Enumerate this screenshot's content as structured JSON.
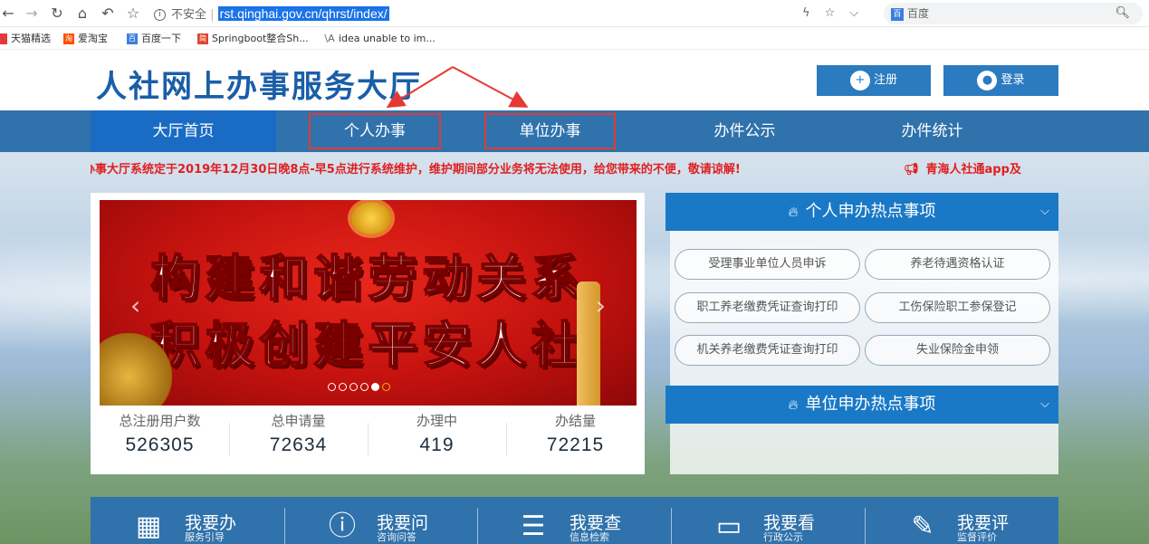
{
  "browser": {
    "security_label": "不安全",
    "url": "rst.qinghai.gov.cn/qhrst/index/",
    "search_engine": "百度",
    "icons": [
      "back-icon",
      "forward-icon",
      "reload-icon",
      "home-icon",
      "history-back-icon",
      "star-icon"
    ]
  },
  "bookmarks": [
    {
      "label": "天猫精选",
      "color": "#e4393c"
    },
    {
      "label": "爱淘宝",
      "color": "#ff5000"
    },
    {
      "label": "百度一下",
      "color": "#3a7fe0"
    },
    {
      "label": "Springboot整合Sh...",
      "color": "#e2452f"
    },
    {
      "label": "idea unable to im...",
      "color": "#666666"
    }
  ],
  "header": {
    "title": "人社网上办事服务大厅",
    "register_label": "注册",
    "login_label": "登录"
  },
  "nav": [
    {
      "label": "大厅首页"
    },
    {
      "label": "个人办事"
    },
    {
      "label": "单位办事"
    },
    {
      "label": "办件公示"
    },
    {
      "label": "办件统计"
    }
  ],
  "notice": {
    "text": "办事大厅系统定于2019年12月30日晚8点-早5点进行系统维护，维护期间部分业务将无法使用，给您带来的不便，敬请谅解!",
    "text_visible": "办事大厅系统定于2019年12月30日晚8点-早5点进行系统维护，维护期间部分业务将无法使用，给您带来的不便，敬请谅解!",
    "second": "青海人社通app及"
  },
  "banner": {
    "line1": "构建和谐劳动关系",
    "line2": "积极创建平安人社",
    "slides": 6,
    "active_slide": 5
  },
  "stats": [
    {
      "label": "总注册用户数",
      "value": "526305"
    },
    {
      "label": "总申请量",
      "value": "72634"
    },
    {
      "label": "办理中",
      "value": "419"
    },
    {
      "label": "办结量",
      "value": "72215"
    }
  ],
  "personal_hot": {
    "title": "个人申办热点事项",
    "items": [
      "受理事业单位人员申诉",
      "养老待遇资格认证",
      "职工养老缴费凭证查询打印",
      "工伤保险职工参保登记",
      "机关养老缴费凭证查询打印",
      "失业保险金申领"
    ]
  },
  "unit_hot": {
    "title": "单位申办热点事项"
  },
  "services": [
    {
      "title": "我要办",
      "sub": "服务引导",
      "icon": "calendar-icon"
    },
    {
      "title": "我要问",
      "sub": "咨询问答",
      "icon": "question-icon"
    },
    {
      "title": "我要查",
      "sub": "信息检索",
      "icon": "search-list-icon"
    },
    {
      "title": "我要看",
      "sub": "行政公示",
      "icon": "monitor-icon"
    },
    {
      "title": "我要评",
      "sub": "监督评价",
      "icon": "edit-icon"
    }
  ],
  "colors": {
    "brand_blue": "#2f72ac",
    "accent_red": "#e01f1f",
    "title_blue": "#1a5ea8"
  }
}
